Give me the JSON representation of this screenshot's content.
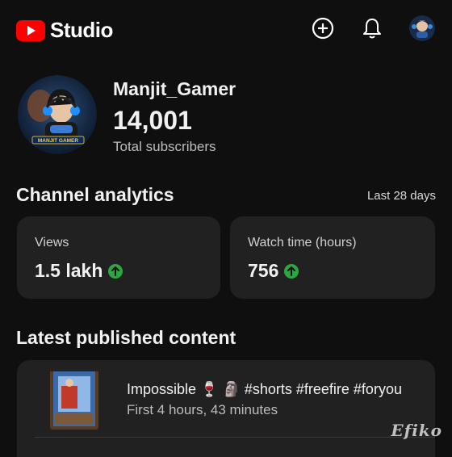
{
  "app": {
    "title": "Studio",
    "logo_icon": "youtube-logo-icon",
    "brand_color": "#ff0000"
  },
  "topbar": {
    "create_icon": "plus-circle-icon",
    "notifications_icon": "bell-icon"
  },
  "channel": {
    "name": "Manjit_Gamer",
    "subscribers": "14,001",
    "subscribers_label": "Total subscribers",
    "avatar_text": "MANJIT GAMER"
  },
  "analytics": {
    "title": "Channel analytics",
    "period": "Last 28 days",
    "cards": [
      {
        "label": "Views",
        "value": "1.5 lakh",
        "trend": "up"
      },
      {
        "label": "Watch time (hours)",
        "value": "756",
        "trend": "up"
      }
    ],
    "trend_color": "#2ba640"
  },
  "latest": {
    "title": "Latest published content",
    "video": {
      "title": "Impossible 🍷 🗿 #shorts #freefire #foryou",
      "meta": "First 4 hours, 43 minutes"
    }
  },
  "watermark": "Efiko"
}
